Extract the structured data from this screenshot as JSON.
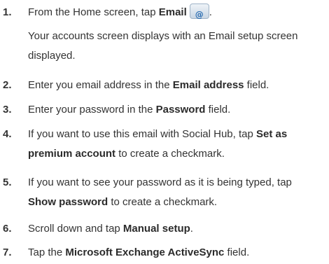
{
  "steps": [
    {
      "num": "1.",
      "pre": "From the Home screen, tap ",
      "bold": "Email",
      "post": "",
      "cont1": "Your accounts screen displays with an Email setup screen",
      "cont2": "displayed."
    },
    {
      "num": "2.",
      "pre": "Enter you email address in the ",
      "bold": "Email address",
      "post": " field."
    },
    {
      "num": "3.",
      "pre": "Enter your password in the ",
      "bold": "Password",
      "post": " field."
    },
    {
      "num": "4.",
      "pre": "If you want to use this email with Social Hub, tap ",
      "bold": "Set as",
      "cont_bold": "premium account",
      "cont_post": " to create a checkmark."
    },
    {
      "num": "5.",
      "pre": "If you want to see your password as it is being typed, tap",
      "bold": "",
      "post": "",
      "cont_bold": "Show password",
      "cont_post": " to create a checkmark."
    },
    {
      "num": "6.",
      "pre": "Scroll down and tap ",
      "bold": "Manual setup",
      "post": "."
    },
    {
      "num": "7.",
      "pre": "Tap the ",
      "bold": "Microsoft Exchange ActiveSync",
      "post": " field."
    }
  ],
  "icons": {
    "email": "email-app-icon"
  }
}
